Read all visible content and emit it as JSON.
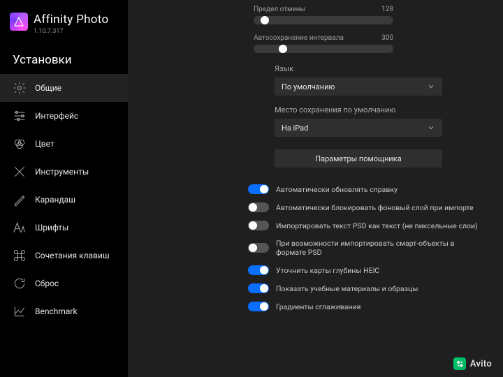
{
  "brand": {
    "title": "Affinity Photo",
    "version": "1.10.7.317"
  },
  "section_title": "Установки",
  "sidebar": {
    "items": [
      {
        "label": "Общие"
      },
      {
        "label": "Интерфейс"
      },
      {
        "label": "Цвет"
      },
      {
        "label": "Инструменты"
      },
      {
        "label": "Карандаш"
      },
      {
        "label": "Шрифты"
      },
      {
        "label": "Сочетания клавиш"
      },
      {
        "label": "Сброс"
      },
      {
        "label": "Benchmark"
      }
    ]
  },
  "sliders": {
    "undo": {
      "label": "Предел отмены",
      "value": "128",
      "pos_pct": 5
    },
    "autosave": {
      "label": "Автосохранение интервала",
      "value": "300",
      "pos_pct": 18
    }
  },
  "language": {
    "label": "Язык",
    "selected": "По умолчанию"
  },
  "save_location": {
    "label": "Место сохранения по умолчанию",
    "selected": "На iPad"
  },
  "helper_button": "Параметры помощника",
  "toggles": [
    {
      "label": "Автоматически обновлять справку",
      "on": true
    },
    {
      "label": "Автоматически блокировать фоновый слой при импорте",
      "on": false
    },
    {
      "label": "Импортировать текст PSD как текст (не пиксельные слои)",
      "on": false
    },
    {
      "label": "При возможности импортировать смарт-объекты в формате PSD",
      "on": false
    },
    {
      "label": "Уточнить карты глубины HEIC",
      "on": true
    },
    {
      "label": "Показать учебные материалы и образцы",
      "on": true
    },
    {
      "label": "Градиенты сглаживания",
      "on": true
    }
  ],
  "watermark": "Avito"
}
